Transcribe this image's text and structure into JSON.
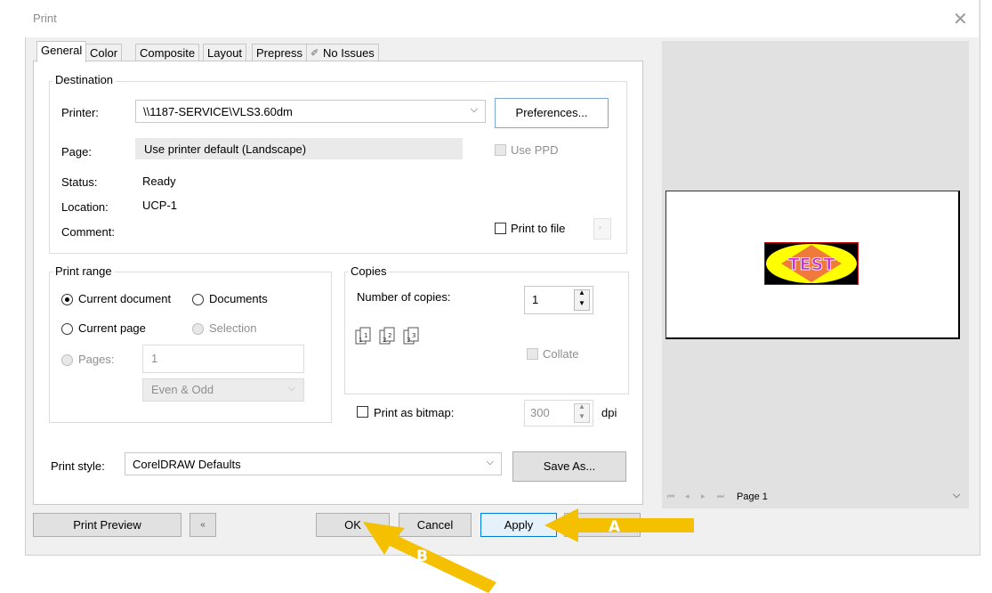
{
  "window": {
    "title": "Print"
  },
  "tabs": [
    "General",
    "Color",
    "Composite",
    "Layout",
    "Prepress",
    "No Issues"
  ],
  "destination": {
    "group_label": "Destination",
    "printer_label": "Printer:",
    "printer_value": "\\\\1187-SERVICE\\VLS3.60dm",
    "preferences_button": "Preferences...",
    "page_label": "Page:",
    "page_value": "Use printer default (Landscape)",
    "use_ppd_label": "Use PPD",
    "status_label": "Status:",
    "status_value": "Ready",
    "location_label": "Location:",
    "location_value": "UCP-1",
    "comment_label": "Comment:",
    "print_to_file_label": "Print to file"
  },
  "print_range": {
    "group_label": "Print range",
    "current_document": "Current document",
    "documents": "Documents",
    "current_page": "Current page",
    "selection": "Selection",
    "pages_label": "Pages:",
    "pages_value": "1",
    "even_odd": "Even & Odd"
  },
  "copies": {
    "group_label": "Copies",
    "number_label": "Number of copies:",
    "number_value": "1",
    "collate_label": "Collate"
  },
  "bitmap": {
    "label": "Print as bitmap:",
    "dpi_value": "300",
    "dpi_unit": "dpi"
  },
  "print_style": {
    "label": "Print style:",
    "value": "CorelDRAW Defaults",
    "save_as_button": "Save As..."
  },
  "preview": {
    "graphic_text": "TEST",
    "page_selector": "Page 1"
  },
  "footer": {
    "print_preview": "Print Preview",
    "ok": "OK",
    "cancel": "Cancel",
    "apply": "Apply"
  },
  "annotations": {
    "a": "A",
    "b": "B"
  },
  "colors": {
    "arrow": "#f5c000",
    "ellipse": "#ffff00",
    "diamond": "#f07a3c",
    "text": "#cc33cc"
  }
}
